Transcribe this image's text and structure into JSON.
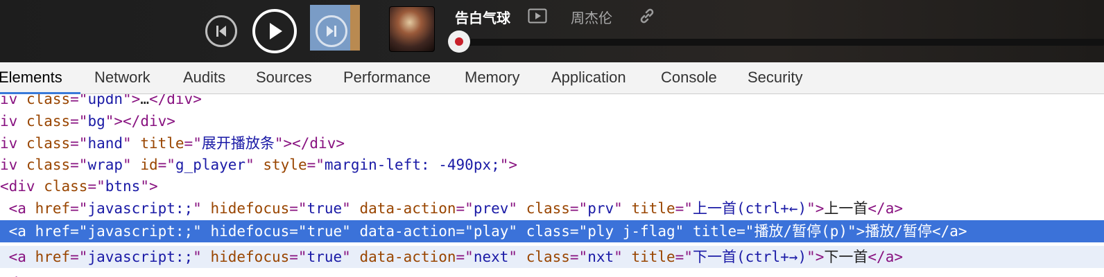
{
  "player": {
    "song_title": "告白气球",
    "artist": "周杰伦",
    "mv_icon": "mv-icon",
    "link_icon": "link-icon",
    "prev_icon": "skip-previous-icon",
    "play_icon": "play-icon",
    "next_icon": "skip-next-icon",
    "progress_fraction": 0.0
  },
  "devtools": {
    "tabs": [
      {
        "label": "Elements",
        "active": true
      },
      {
        "label": "Network"
      },
      {
        "label": "Audits"
      },
      {
        "label": "Sources"
      },
      {
        "label": "Performance"
      },
      {
        "label": "Memory"
      },
      {
        "label": "Application"
      },
      {
        "label": "Console"
      },
      {
        "label": "Security"
      }
    ],
    "dom_lines": [
      [
        {
          "t": "tg",
          "v": "iv "
        },
        {
          "t": "an",
          "v": "class"
        },
        {
          "t": "tg",
          "v": "=\""
        },
        {
          "t": "av",
          "v": "updn"
        },
        {
          "t": "tg",
          "v": "\">"
        },
        {
          "t": "tx",
          "v": "…"
        },
        {
          "t": "tg",
          "v": "</div>"
        }
      ],
      [
        {
          "t": "tg",
          "v": "iv "
        },
        {
          "t": "an",
          "v": "class"
        },
        {
          "t": "tg",
          "v": "=\""
        },
        {
          "t": "av",
          "v": "bg"
        },
        {
          "t": "tg",
          "v": "\"></div>"
        }
      ],
      [
        {
          "t": "tg",
          "v": "iv "
        },
        {
          "t": "an",
          "v": "class"
        },
        {
          "t": "tg",
          "v": "=\""
        },
        {
          "t": "av",
          "v": "hand"
        },
        {
          "t": "tg",
          "v": "\" "
        },
        {
          "t": "an",
          "v": "title"
        },
        {
          "t": "tg",
          "v": "=\""
        },
        {
          "t": "av",
          "v": "展开播放条"
        },
        {
          "t": "tg",
          "v": "\"></div>"
        }
      ],
      [
        {
          "t": "tg",
          "v": "iv "
        },
        {
          "t": "an",
          "v": "class"
        },
        {
          "t": "tg",
          "v": "=\""
        },
        {
          "t": "av",
          "v": "wrap"
        },
        {
          "t": "tg",
          "v": "\" "
        },
        {
          "t": "an",
          "v": "id"
        },
        {
          "t": "tg",
          "v": "=\""
        },
        {
          "t": "av",
          "v": "g_player"
        },
        {
          "t": "tg",
          "v": "\" "
        },
        {
          "t": "an",
          "v": "style"
        },
        {
          "t": "tg",
          "v": "=\""
        },
        {
          "t": "av",
          "v": "margin-left: -490px;"
        },
        {
          "t": "tg",
          "v": "\">"
        }
      ],
      [
        {
          "t": "tg",
          "v": "<div "
        },
        {
          "t": "an",
          "v": "class"
        },
        {
          "t": "tg",
          "v": "=\""
        },
        {
          "t": "av",
          "v": "btns"
        },
        {
          "t": "tg",
          "v": "\">"
        }
      ],
      [
        {
          "t": "tg",
          "v": " <a "
        },
        {
          "t": "an",
          "v": "href"
        },
        {
          "t": "tg",
          "v": "=\""
        },
        {
          "t": "av",
          "v": "javascript:;"
        },
        {
          "t": "tg",
          "v": "\" "
        },
        {
          "t": "an",
          "v": "hidefocus"
        },
        {
          "t": "tg",
          "v": "=\""
        },
        {
          "t": "av",
          "v": "true"
        },
        {
          "t": "tg",
          "v": "\" "
        },
        {
          "t": "an",
          "v": "data-action"
        },
        {
          "t": "tg",
          "v": "=\""
        },
        {
          "t": "av",
          "v": "prev"
        },
        {
          "t": "tg",
          "v": "\" "
        },
        {
          "t": "an",
          "v": "class"
        },
        {
          "t": "tg",
          "v": "=\""
        },
        {
          "t": "av",
          "v": "prv"
        },
        {
          "t": "tg",
          "v": "\" "
        },
        {
          "t": "an",
          "v": "title"
        },
        {
          "t": "tg",
          "v": "=\""
        },
        {
          "t": "av",
          "v": "上一首(ctrl+←)"
        },
        {
          "t": "tg",
          "v": "\">"
        },
        {
          "t": "tx",
          "v": "上一首"
        },
        {
          "t": "tg",
          "v": "</a>"
        }
      ],
      [
        {
          "t": "tg",
          "v": " <a "
        },
        {
          "t": "an",
          "v": "href"
        },
        {
          "t": "tg",
          "v": "=\""
        },
        {
          "t": "av",
          "v": "javascript:;"
        },
        {
          "t": "tg",
          "v": "\" "
        },
        {
          "t": "an",
          "v": "hidefocus"
        },
        {
          "t": "tg",
          "v": "=\""
        },
        {
          "t": "av",
          "v": "true"
        },
        {
          "t": "tg",
          "v": "\" "
        },
        {
          "t": "an",
          "v": "data-action"
        },
        {
          "t": "tg",
          "v": "=\""
        },
        {
          "t": "av",
          "v": "play"
        },
        {
          "t": "tg",
          "v": "\" "
        },
        {
          "t": "an",
          "v": "class"
        },
        {
          "t": "tg",
          "v": "=\""
        },
        {
          "t": "av",
          "v": "ply j-flag"
        },
        {
          "t": "tg",
          "v": "\" "
        },
        {
          "t": "an",
          "v": "title"
        },
        {
          "t": "tg",
          "v": "=\""
        },
        {
          "t": "av",
          "v": "播放/暂停(p)"
        },
        {
          "t": "tg",
          "v": "\">"
        },
        {
          "t": "tx",
          "v": "播放/暂停"
        },
        {
          "t": "tg",
          "v": "</a>"
        }
      ],
      [
        {
          "t": "tg",
          "v": " <a "
        },
        {
          "t": "an",
          "v": "href"
        },
        {
          "t": "tg",
          "v": "=\""
        },
        {
          "t": "av",
          "v": "javascript:;"
        },
        {
          "t": "tg",
          "v": "\" "
        },
        {
          "t": "an",
          "v": "hidefocus"
        },
        {
          "t": "tg",
          "v": "=\""
        },
        {
          "t": "av",
          "v": "true"
        },
        {
          "t": "tg",
          "v": "\" "
        },
        {
          "t": "an",
          "v": "data-action"
        },
        {
          "t": "tg",
          "v": "=\""
        },
        {
          "t": "av",
          "v": "next"
        },
        {
          "t": "tg",
          "v": "\" "
        },
        {
          "t": "an",
          "v": "class"
        },
        {
          "t": "tg",
          "v": "=\""
        },
        {
          "t": "av",
          "v": "nxt"
        },
        {
          "t": "tg",
          "v": "\" "
        },
        {
          "t": "an",
          "v": "title"
        },
        {
          "t": "tg",
          "v": "=\""
        },
        {
          "t": "av",
          "v": "下一首(ctrl+→)"
        },
        {
          "t": "tg",
          "v": "\">"
        },
        {
          "t": "tx",
          "v": "下一首"
        },
        {
          "t": "tg",
          "v": "</a>"
        }
      ],
      [
        {
          "t": "tg",
          "v": " <"
        }
      ]
    ],
    "selected_line": 6,
    "hover_line": 7
  },
  "colors": {
    "selection": "#3b72d9",
    "tab_active_underline": "#3879d9",
    "tag": "#881280",
    "attr_name": "#994500",
    "attr_value": "#1a1aa6",
    "progress_dot": "#c8202a",
    "next_highlight_blue": "#7a9cc6",
    "next_highlight_orange": "#b98a51"
  }
}
